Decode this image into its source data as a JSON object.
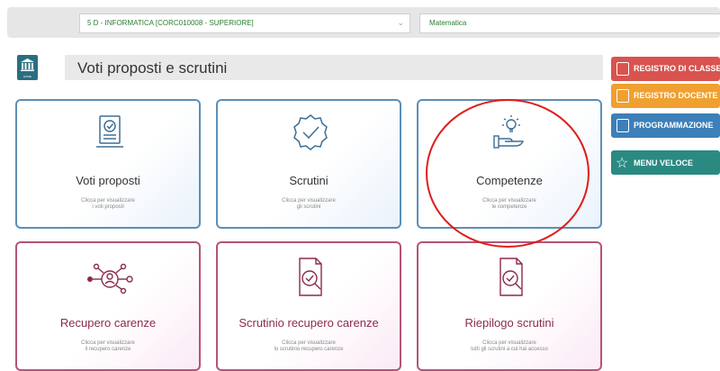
{
  "header": {
    "class_select_value": "5 D - INFORMATICA [CORC010008 - SUPERIORE]",
    "subject_select_value": "Matematica",
    "home_label": "HOME",
    "page_title": "Voti proposti e scrutini"
  },
  "cards": [
    {
      "title": "Voti proposti",
      "subtitle_line1": "Clicca per visualizzare",
      "subtitle_line2": "i voti proposti",
      "icon": "document-check-icon"
    },
    {
      "title": "Scrutini",
      "subtitle_line1": "Clicca per visualizzare",
      "subtitle_line2": "gli scrutini",
      "icon": "badge-check-icon"
    },
    {
      "title": "Competenze",
      "subtitle_line1": "Clicca per visualizzare",
      "subtitle_line2": "le competenze",
      "icon": "lightbulb-hand-icon"
    },
    {
      "title": "Recupero carenze",
      "subtitle_line1": "Clicca per visualizzare",
      "subtitle_line2": "il recupero carenze",
      "icon": "user-network-icon"
    },
    {
      "title": "Scrutinio recupero carenze",
      "subtitle_line1": "Clicca per visualizzare",
      "subtitle_line2": "lo scrutinio recupero carenze",
      "icon": "document-search-icon"
    },
    {
      "title": "Riepilogo scrutini",
      "subtitle_line1": "Clicca per visualizzare",
      "subtitle_line2": "tutti gli scrutini a cui hai accesso",
      "icon": "document-search-icon"
    }
  ],
  "sidebar": {
    "registro_classe": "REGISTRO DI CLASSE",
    "registro_docente": "REGISTRO DOCENTE",
    "programmazione": "PROGRAMMAZIONE",
    "menu_veloce": "MENU VELOCE"
  },
  "colors": {
    "registro_classe": "#d9534f",
    "registro_docente": "#f0a030",
    "programmazione": "#3d7fb8",
    "menu_veloce": "#2a8a82",
    "card_blue_border": "#5b8fb7",
    "card_pink_border": "#b4537a",
    "annotation_circle": "#e01c1c"
  }
}
